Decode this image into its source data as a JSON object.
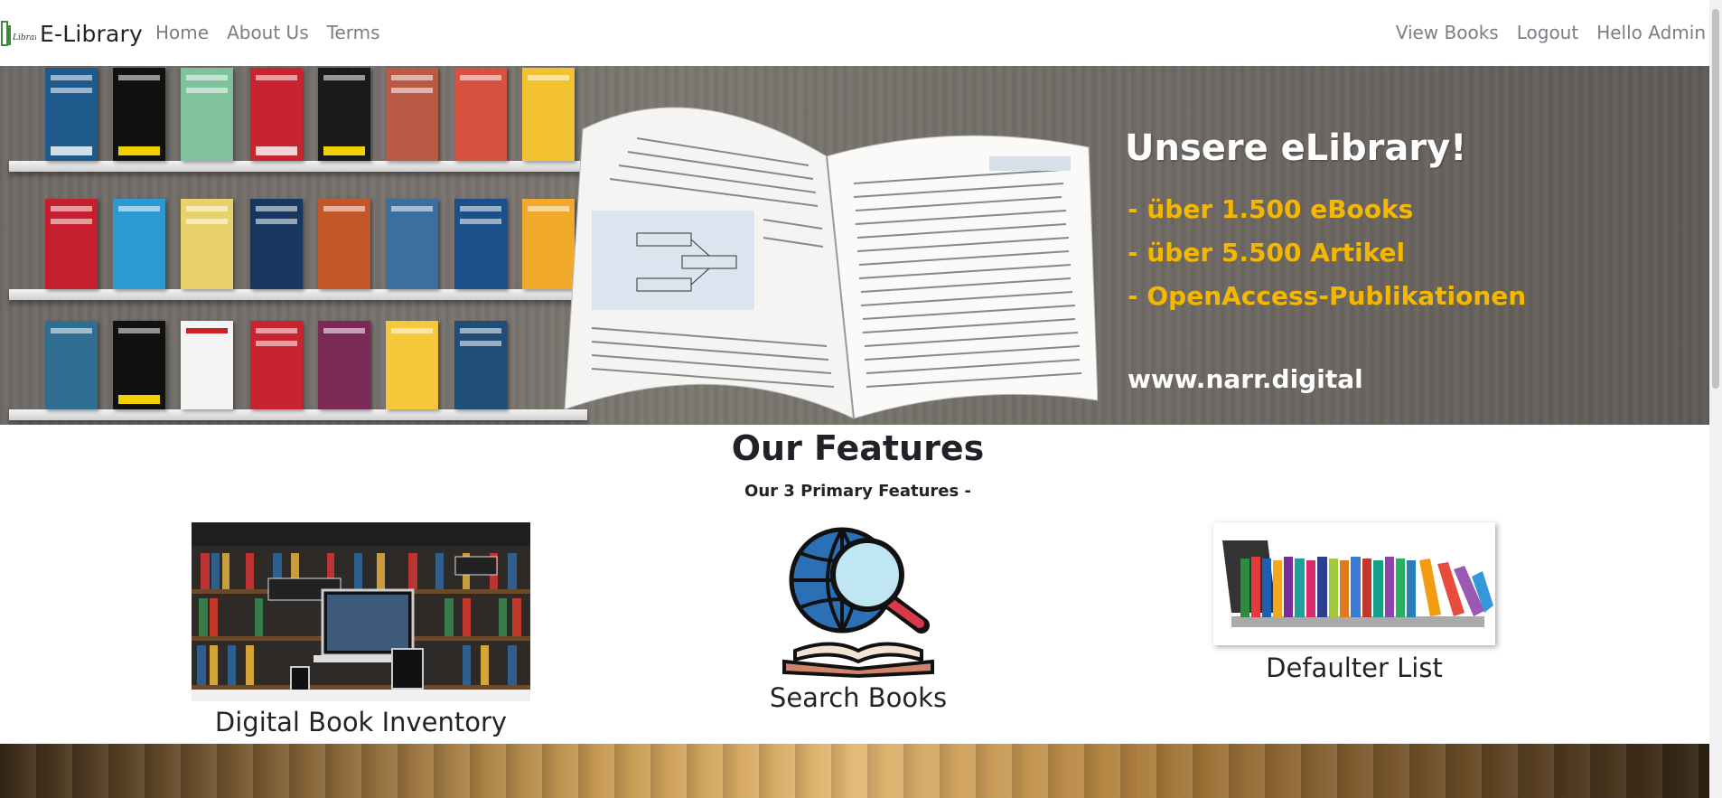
{
  "navbar": {
    "brand_text": "E-Library",
    "left_links": [
      "Home",
      "About Us",
      "Terms"
    ],
    "right_links": [
      "View Books",
      "Logout",
      "Hello Admin"
    ]
  },
  "hero": {
    "headline": "Unsere eLibrary!",
    "bullets": [
      "- über 1.500 eBooks",
      "- über 5.500 Artikel",
      "- OpenAccess-Publikationen"
    ],
    "url": "www.narr.digital",
    "accent_color": "#f5b800"
  },
  "features": {
    "title": "Our Features",
    "subtitle": "Our 3 Primary Features -",
    "cards": [
      {
        "title": "Digital Book Inventory",
        "icon": "bookshelf-laptop-image"
      },
      {
        "title": "Search Books",
        "icon": "globe-search-book-icon"
      },
      {
        "title": "Defaulter List",
        "icon": "laptop-books-image"
      }
    ]
  }
}
